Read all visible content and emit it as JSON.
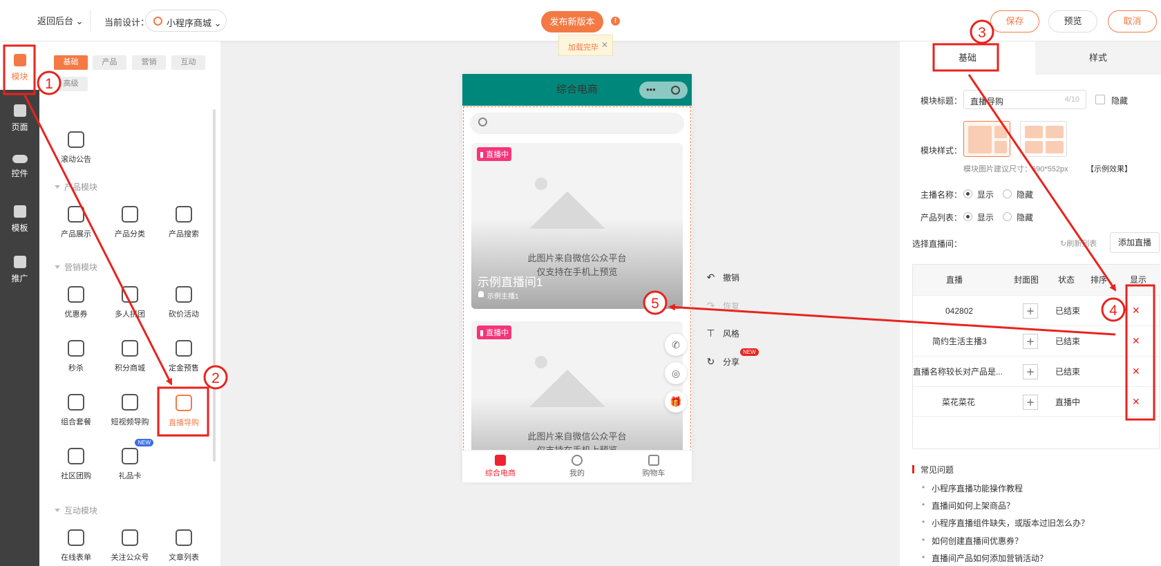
{
  "topbar": {
    "back_label": "返回后台",
    "current_design_label": "当前设计：",
    "current_design_value": "小程序商城",
    "publish_label": "发布新版本",
    "toast": "加载完毕",
    "save_label": "保存",
    "preview_label": "预览",
    "cancel_label": "取消"
  },
  "sidebar": {
    "items": [
      {
        "label": "模块",
        "icon": "module-icon"
      },
      {
        "label": "页面",
        "icon": "page-icon"
      },
      {
        "label": "控件",
        "icon": "toggle-icon"
      },
      {
        "label": "模板",
        "icon": "template-icon"
      },
      {
        "label": "推广",
        "icon": "megaphone-icon"
      }
    ]
  },
  "module_panel": {
    "filter_tabs": [
      "基础",
      "产品",
      "营销",
      "互动",
      "高级"
    ],
    "scroll_notice": "滚动公告",
    "sections": [
      {
        "title": "产品模块",
        "items": [
          "产品展示",
          "产品分类",
          "产品搜索"
        ]
      },
      {
        "title": "营销模块",
        "items": [
          "优惠券",
          "多人拼团",
          "砍价活动",
          "秒杀",
          "积分商城",
          "定金预售",
          "组合套餐",
          "短视频导购",
          "直播导购",
          "社区团购",
          "礼品卡"
        ]
      },
      {
        "title": "互动模块",
        "items": [
          "在线表单",
          "关注公众号",
          "文章列表"
        ]
      }
    ],
    "new_badge": "NEW"
  },
  "phone": {
    "title": "综合电商",
    "cards": [
      {
        "badge": "直播中",
        "note": "此图片来自微信公众平台",
        "note2": "仅支持在手机上预览",
        "title": "示例直播间1",
        "anchor": "示例主播1"
      },
      {
        "badge": "直播中",
        "note": "此图片来自微信公众平台",
        "note2": "仅支持在手机上预览"
      }
    ],
    "tabbar": [
      "综合电商",
      "我的",
      "购物车"
    ]
  },
  "side_actions": {
    "undo": "撤销",
    "redo": "恢复",
    "style": "风格",
    "share": "分享",
    "new_badge": "NEW"
  },
  "settings": {
    "tabs": [
      "基础",
      "样式"
    ],
    "module_title_label": "模块标题：",
    "module_title_value": "直播导购",
    "module_title_count": "4/10",
    "hide_label": "隐藏",
    "module_style_label": "模块样式：",
    "image_hint": "模块图片建议尺寸：690*552px",
    "example_link": "【示例效果】",
    "anchor_name_label": "主播名称：",
    "product_list_label": "产品列表：",
    "show_label": "显示",
    "hide_option_label": "隐藏",
    "select_live_label": "选择直播间：",
    "refresh_label": "刷新列表",
    "add_live_label": "添加直播",
    "table_headers": [
      "直播",
      "封面图",
      "状态",
      "排序",
      "显示"
    ],
    "rows": [
      {
        "name": "042802",
        "status": "已结束"
      },
      {
        "name": "简约生活主播3",
        "status": "已结束"
      },
      {
        "name": "直播名称较长对产品是...",
        "status": "已结束"
      },
      {
        "name": "菜花菜花",
        "status": "直播中"
      }
    ],
    "faq_title": "常见问题",
    "faqs": [
      "小程序直播功能操作教程",
      "直播间如何上架商品？",
      "小程序直播组件缺失，或版本过旧怎么办？",
      "如何创建直播间优惠券？",
      "直播间产品如何添加营销活动？"
    ]
  },
  "annotations": [
    "1",
    "2",
    "3",
    "4",
    "5"
  ],
  "colors": {
    "accent": "#f37a44",
    "header": "#00877b",
    "annotation": "#e8231e",
    "live_badge": "#f5357a"
  }
}
